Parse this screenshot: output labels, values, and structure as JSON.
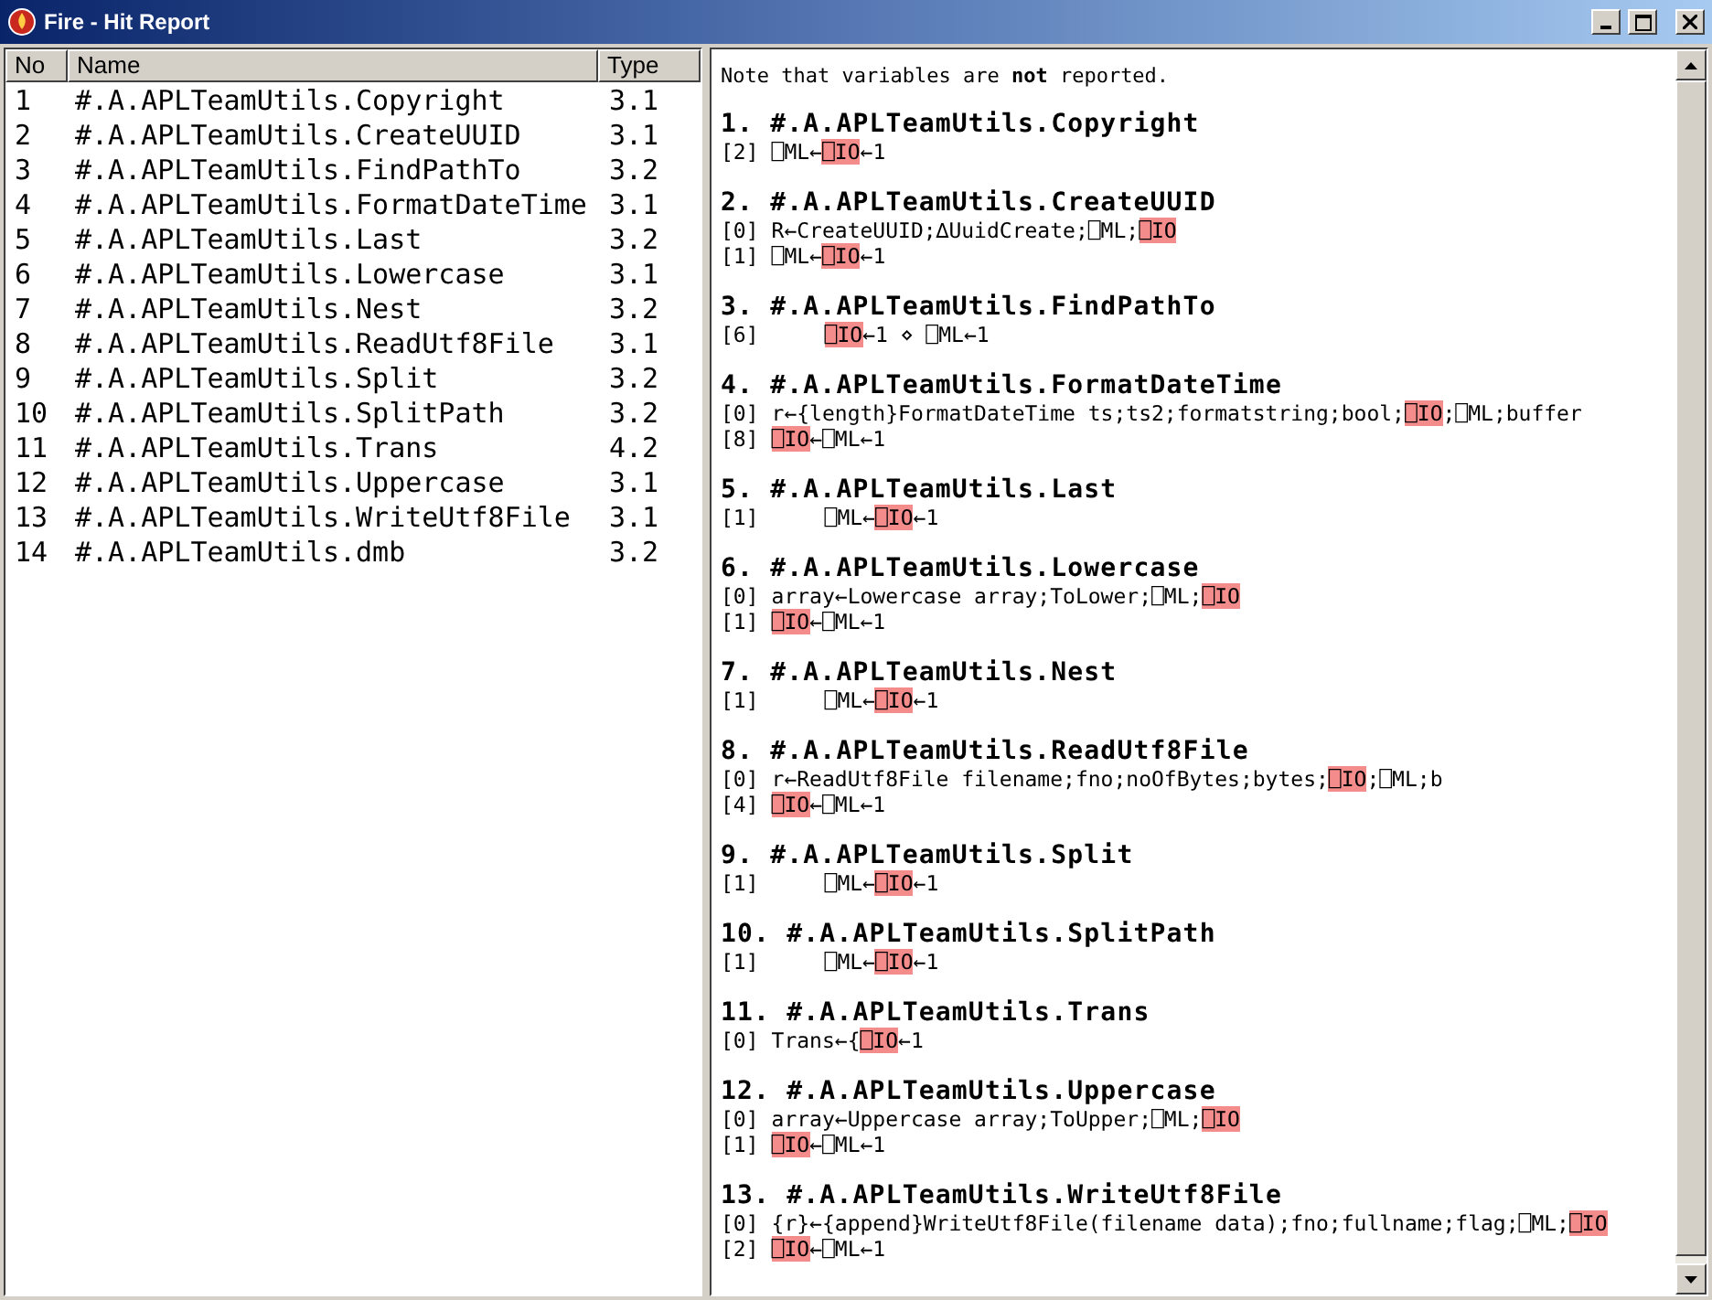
{
  "window": {
    "title": "Fire - Hit Report"
  },
  "table": {
    "columns": [
      "No",
      "Name",
      "Type"
    ],
    "rows": [
      {
        "no": "1",
        "name": "#.A.APLTeamUtils.Copyright",
        "type": "3.1"
      },
      {
        "no": "2",
        "name": "#.A.APLTeamUtils.CreateUUID",
        "type": "3.1"
      },
      {
        "no": "3",
        "name": "#.A.APLTeamUtils.FindPathTo",
        "type": "3.2"
      },
      {
        "no": "4",
        "name": "#.A.APLTeamUtils.FormatDateTime",
        "type": "3.1"
      },
      {
        "no": "5",
        "name": "#.A.APLTeamUtils.Last",
        "type": "3.2"
      },
      {
        "no": "6",
        "name": "#.A.APLTeamUtils.Lowercase",
        "type": "3.1"
      },
      {
        "no": "7",
        "name": "#.A.APLTeamUtils.Nest",
        "type": "3.2"
      },
      {
        "no": "8",
        "name": "#.A.APLTeamUtils.ReadUtf8File",
        "type": "3.1"
      },
      {
        "no": "9",
        "name": "#.A.APLTeamUtils.Split",
        "type": "3.2"
      },
      {
        "no": "10",
        "name": "#.A.APLTeamUtils.SplitPath",
        "type": "3.2"
      },
      {
        "no": "11",
        "name": "#.A.APLTeamUtils.Trans",
        "type": "4.2"
      },
      {
        "no": "12",
        "name": "#.A.APLTeamUtils.Uppercase",
        "type": "3.1"
      },
      {
        "no": "13",
        "name": "#.A.APLTeamUtils.WriteUtf8File",
        "type": "3.1"
      },
      {
        "no": "14",
        "name": "#.A.APLTeamUtils.dmb",
        "type": "3.2"
      }
    ]
  },
  "report": {
    "note": "Note that variables are **not** reported.",
    "sections": [
      {
        "heading": "1. #.A.APLTeamUtils.Copyright",
        "lines": [
          {
            "num": "[2]",
            "indented": false,
            "segments": [
              {
                "text": "⎕ML←",
                "highlight": false
              },
              {
                "text": "⎕IO",
                "highlight": true
              },
              {
                "text": "←1",
                "highlight": false
              }
            ]
          }
        ]
      },
      {
        "heading": "2. #.A.APLTeamUtils.CreateUUID",
        "lines": [
          {
            "num": "[0]",
            "indented": false,
            "segments": [
              {
                "text": "R←CreateUUID;∆UuidCreate;⎕ML;",
                "highlight": false
              },
              {
                "text": "⎕IO",
                "highlight": true
              }
            ]
          },
          {
            "num": "[1]",
            "indented": false,
            "segments": [
              {
                "text": "⎕ML←",
                "highlight": false
              },
              {
                "text": "⎕IO",
                "highlight": true
              },
              {
                "text": "←1",
                "highlight": false
              }
            ]
          }
        ]
      },
      {
        "heading": "3. #.A.APLTeamUtils.FindPathTo",
        "lines": [
          {
            "num": "[6]",
            "indented": true,
            "segments": [
              {
                "text": "⎕IO",
                "highlight": true
              },
              {
                "text": "←1 ⋄ ⎕ML←1",
                "highlight": false
              }
            ]
          }
        ]
      },
      {
        "heading": "4. #.A.APLTeamUtils.FormatDateTime",
        "lines": [
          {
            "num": "[0]",
            "indented": false,
            "segments": [
              {
                "text": "r←{length}FormatDateTime ts;ts2;formatstring;bool;",
                "highlight": false
              },
              {
                "text": "⎕IO",
                "highlight": true
              },
              {
                "text": ";⎕ML;buffer",
                "highlight": false
              }
            ]
          },
          {
            "num": "[8]",
            "indented": false,
            "segments": [
              {
                "text": "⎕IO",
                "highlight": true
              },
              {
                "text": "←⎕ML←1",
                "highlight": false
              }
            ]
          }
        ]
      },
      {
        "heading": "5. #.A.APLTeamUtils.Last",
        "lines": [
          {
            "num": "[1]",
            "indented": true,
            "segments": [
              {
                "text": "⎕ML←",
                "highlight": false
              },
              {
                "text": "⎕IO",
                "highlight": true
              },
              {
                "text": "←1",
                "highlight": false
              }
            ]
          }
        ]
      },
      {
        "heading": "6. #.A.APLTeamUtils.Lowercase",
        "lines": [
          {
            "num": "[0]",
            "indented": false,
            "segments": [
              {
                "text": "array←Lowercase array;ToLower;⎕ML;",
                "highlight": false
              },
              {
                "text": "⎕IO",
                "highlight": true
              }
            ]
          },
          {
            "num": "[1]",
            "indented": false,
            "segments": [
              {
                "text": "⎕IO",
                "highlight": true
              },
              {
                "text": "←⎕ML←1",
                "highlight": false
              }
            ]
          }
        ]
      },
      {
        "heading": "7. #.A.APLTeamUtils.Nest",
        "lines": [
          {
            "num": "[1]",
            "indented": true,
            "segments": [
              {
                "text": "⎕ML←",
                "highlight": false
              },
              {
                "text": "⎕IO",
                "highlight": true
              },
              {
                "text": "←1",
                "highlight": false
              }
            ]
          }
        ]
      },
      {
        "heading": "8. #.A.APLTeamUtils.ReadUtf8File",
        "lines": [
          {
            "num": "[0]",
            "indented": false,
            "segments": [
              {
                "text": "r←ReadUtf8File filename;fno;noOfBytes;bytes;",
                "highlight": false
              },
              {
                "text": "⎕IO",
                "highlight": true
              },
              {
                "text": ";⎕ML;b",
                "highlight": false
              }
            ]
          },
          {
            "num": "[4]",
            "indented": false,
            "segments": [
              {
                "text": "⎕IO",
                "highlight": true
              },
              {
                "text": "←⎕ML←1",
                "highlight": false
              }
            ]
          }
        ]
      },
      {
        "heading": "9. #.A.APLTeamUtils.Split",
        "lines": [
          {
            "num": "[1]",
            "indented": true,
            "segments": [
              {
                "text": "⎕ML←",
                "highlight": false
              },
              {
                "text": "⎕IO",
                "highlight": true
              },
              {
                "text": "←1",
                "highlight": false
              }
            ]
          }
        ]
      },
      {
        "heading": "10. #.A.APLTeamUtils.SplitPath",
        "lines": [
          {
            "num": "[1]",
            "indented": true,
            "segments": [
              {
                "text": "⎕ML←",
                "highlight": false
              },
              {
                "text": "⎕IO",
                "highlight": true
              },
              {
                "text": "←1",
                "highlight": false
              }
            ]
          }
        ]
      },
      {
        "heading": "11. #.A.APLTeamUtils.Trans",
        "lines": [
          {
            "num": "[0]",
            "indented": false,
            "segments": [
              {
                "text": "Trans←{",
                "highlight": false
              },
              {
                "text": "⎕IO",
                "highlight": true
              },
              {
                "text": "←1",
                "highlight": false
              }
            ]
          }
        ]
      },
      {
        "heading": "12. #.A.APLTeamUtils.Uppercase",
        "lines": [
          {
            "num": "[0]",
            "indented": false,
            "segments": [
              {
                "text": "array←Uppercase array;ToUpper;⎕ML;",
                "highlight": false
              },
              {
                "text": "⎕IO",
                "highlight": true
              }
            ]
          },
          {
            "num": "[1]",
            "indented": false,
            "segments": [
              {
                "text": "⎕IO",
                "highlight": true
              },
              {
                "text": "←⎕ML←1",
                "highlight": false
              }
            ]
          }
        ]
      },
      {
        "heading": "13. #.A.APLTeamUtils.WriteUtf8File",
        "lines": [
          {
            "num": "[0]",
            "indented": false,
            "segments": [
              {
                "text": "{r}←{append}WriteUtf8File(filename data);fno;fullname;flag;⎕ML;",
                "highlight": false
              },
              {
                "text": "⎕IO",
                "highlight": true
              }
            ]
          },
          {
            "num": "[2]",
            "indented": false,
            "segments": [
              {
                "text": "⎕IO",
                "highlight": true
              },
              {
                "text": "←⎕ML←1",
                "highlight": false
              }
            ]
          }
        ]
      }
    ]
  }
}
